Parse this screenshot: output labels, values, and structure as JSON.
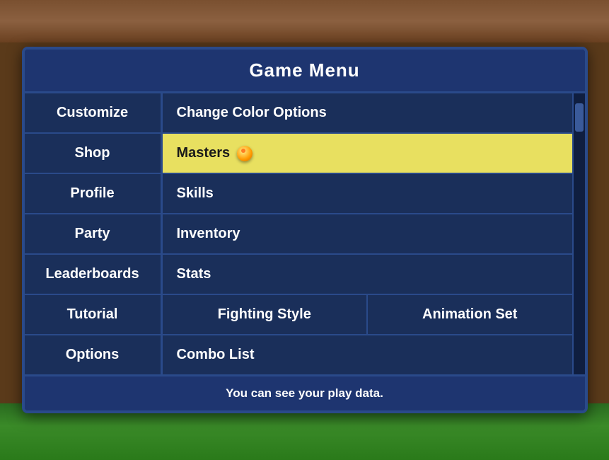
{
  "background": {
    "top_color": "#7a5030",
    "bottom_color": "#3a8a28"
  },
  "menu": {
    "title": "Game Menu",
    "left_items": [
      {
        "label": "Customize"
      },
      {
        "label": "Shop"
      },
      {
        "label": "Profile"
      },
      {
        "label": "Party"
      },
      {
        "label": "Leaderboards"
      },
      {
        "label": "Tutorial"
      },
      {
        "label": "Options"
      }
    ],
    "right_items": [
      {
        "label": "Change Color Options",
        "highlighted": false,
        "split": false
      },
      {
        "label": "Masters",
        "highlighted": true,
        "split": false
      },
      {
        "label": "Skills",
        "highlighted": false,
        "split": false
      },
      {
        "label": "Inventory",
        "highlighted": false,
        "split": false
      },
      {
        "label": "Stats",
        "highlighted": false,
        "split": false
      },
      {
        "label": "Fighting Style",
        "label2": "Animation Set",
        "highlighted": false,
        "split": true
      },
      {
        "label": "Combo List",
        "highlighted": false,
        "split": false
      }
    ],
    "footer": "You can see your play data."
  }
}
